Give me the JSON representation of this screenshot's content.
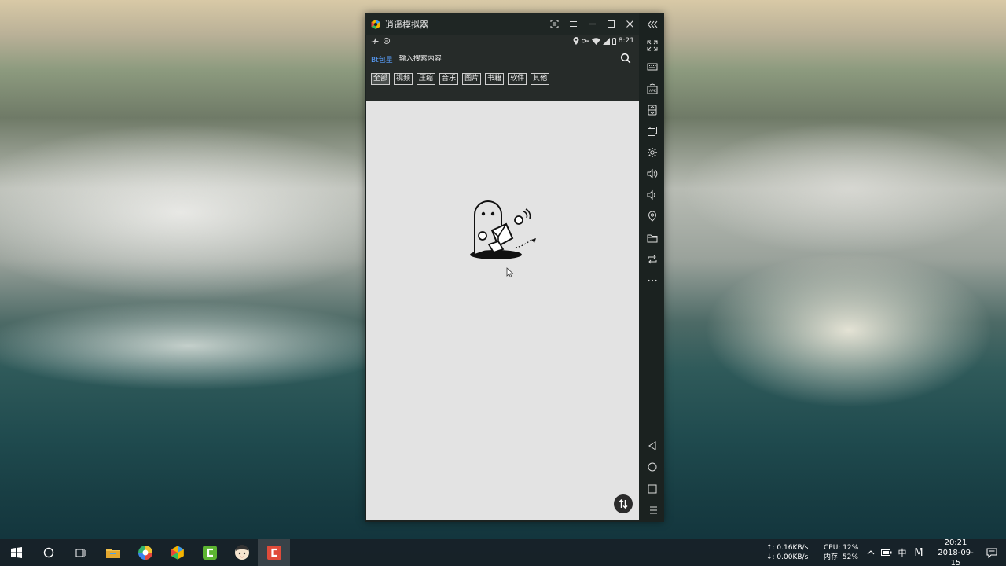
{
  "emulator": {
    "title": "逍遥模拟器",
    "window_buttons": [
      "screenshot-icon",
      "menu-icon",
      "minimize-icon",
      "maximize-icon",
      "close-icon",
      "collapse-icon"
    ]
  },
  "statusbar": {
    "time": "8:21"
  },
  "app": {
    "brand": "Bt包星",
    "search_placeholder": "输入搜索内容",
    "tabs": [
      {
        "label": "全部",
        "active": true
      },
      {
        "label": "视频",
        "active": false
      },
      {
        "label": "压缩",
        "active": false
      },
      {
        "label": "音乐",
        "active": false
      },
      {
        "label": "图片",
        "active": false
      },
      {
        "label": "书籍",
        "active": false
      },
      {
        "label": "软件",
        "active": false
      },
      {
        "label": "其他",
        "active": false
      }
    ]
  },
  "sidebar": {
    "icons": [
      "fullscreen-icon",
      "keyboard-icon",
      "apk-install-icon",
      "multi-instance-icon",
      "window-icon",
      "settings-icon",
      "volume-up-icon",
      "volume-down-icon",
      "location-icon",
      "folder-icon",
      "rotate-icon",
      "more-icon",
      "back-icon",
      "home-icon",
      "recents-icon",
      "list-icon"
    ]
  },
  "taskbar": {
    "apps": [
      "windows-start-icon",
      "cortana-icon",
      "task-view-icon",
      "file-explorer-icon",
      "color-app-icon",
      "emulator-icon",
      "camtasia-icon",
      "avatar-app-icon",
      "red-app-icon"
    ],
    "net_up": "↑: 0.16KB/s",
    "net_down": "↓: 0.00KB/s",
    "cpu": "CPU: 12%",
    "mem": "内存: 52%",
    "ime_mode": "中",
    "ime_letter": "M",
    "time": "20:21",
    "date": "2018-09-15"
  },
  "colors": {
    "accent_blue": "#5aa0ff",
    "titlebar": "#1f2624",
    "app_header": "#262b29",
    "screen_bg": "#e3e3e3"
  }
}
